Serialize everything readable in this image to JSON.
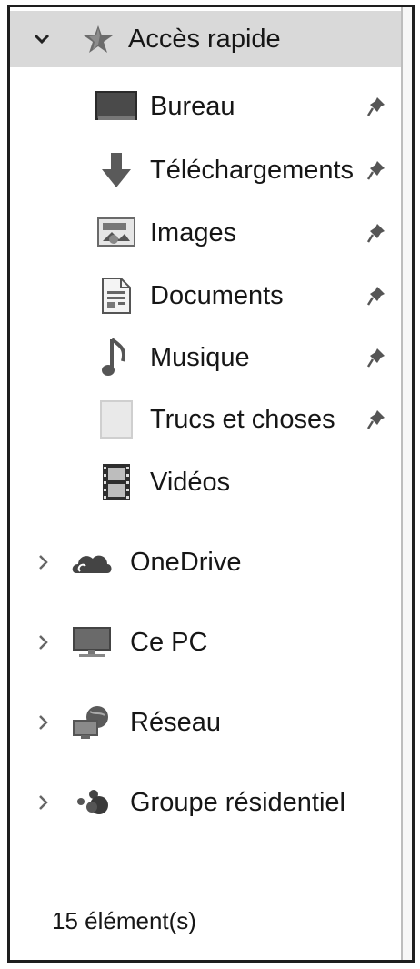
{
  "quick_access": {
    "label": "Accès rapide"
  },
  "pinned_items": [
    {
      "label": "Bureau"
    },
    {
      "label": "Téléchargements"
    },
    {
      "label": "Images"
    },
    {
      "label": "Documents"
    },
    {
      "label": "Musique"
    },
    {
      "label": "Trucs et choses"
    },
    {
      "label": "Vidéos"
    }
  ],
  "locations": [
    {
      "label": "OneDrive"
    },
    {
      "label": "Ce PC"
    },
    {
      "label": "Réseau"
    },
    {
      "label": "Groupe résidentiel"
    }
  ],
  "status_bar": {
    "item_count": "15 élément(s)"
  },
  "colors": {
    "selected_row": "#d9d9d9",
    "border": "#1e1e1e"
  }
}
